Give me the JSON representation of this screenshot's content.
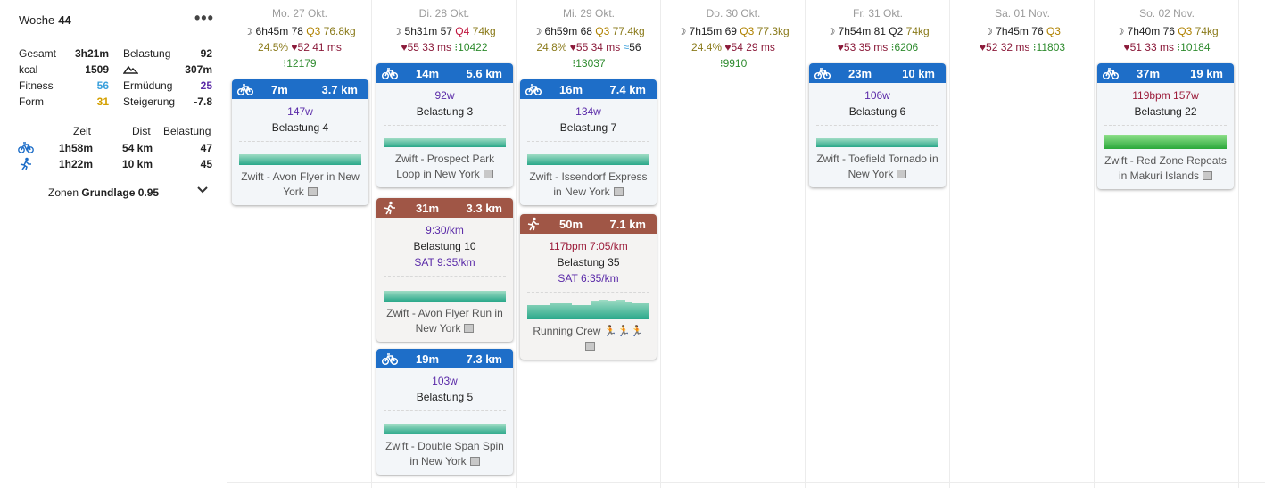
{
  "summary": {
    "woche_label": "Woche",
    "woche_num": "44",
    "gesamt_l": "Gesamt",
    "gesamt_v": "3h21m",
    "kcal_l": "kcal",
    "kcal_v": "1509",
    "fitness_l": "Fitness",
    "fitness_v": "56",
    "form_l": "Form",
    "form_v": "31",
    "belastung_l": "Belastung",
    "belastung_v": "92",
    "elev_v": "307m",
    "ermudung_l": "Ermüdung",
    "ermudung_v": "25",
    "steigerung_l": "Steigerung",
    "steigerung_v": "-7.8",
    "col_zeit": "Zeit",
    "col_dist": "Dist",
    "col_bel": "Belastung",
    "bike_zeit": "1h58m",
    "bike_dist": "54 km",
    "bike_bel": "47",
    "run_zeit": "1h22m",
    "run_dist": "10 km",
    "run_bel": "45",
    "zonen_l": "Zonen",
    "zonen_v": "Grundlage 0.95"
  },
  "days": [
    {
      "date": "Mo. 27 Okt.",
      "sleep": "6h45m",
      "sleep_score": "78",
      "q": "Q3",
      "weight": "76.8kg",
      "pct": "24.5%",
      "hr": "52",
      "hrv": "41 ms",
      "steps": "12179"
    },
    {
      "date": "Di. 28 Okt.",
      "sleep": "5h31m",
      "sleep_score": "57",
      "q": "Q4",
      "weight": "74kg",
      "hr": "55",
      "hrv": "33 ms",
      "steps": "10422"
    },
    {
      "date": "Mi. 29 Okt.",
      "sleep": "6h59m",
      "sleep_score": "68",
      "q": "Q3",
      "weight": "77.4kg",
      "pct": "24.8%",
      "hr": "55",
      "hrv": "34 ms",
      "resp": "56",
      "steps": "13037"
    },
    {
      "date": "Do. 30 Okt.",
      "sleep": "7h15m",
      "sleep_score": "69",
      "q": "Q3",
      "weight": "77.3kg",
      "pct": "24.4%",
      "hr": "54",
      "hrv": "29 ms",
      "steps": "9910"
    },
    {
      "date": "Fr. 31 Okt.",
      "sleep": "7h54m",
      "sleep_score": "81",
      "q": "Q2",
      "weight": "74kg",
      "hr": "53",
      "hrv": "35 ms",
      "steps": "6206"
    },
    {
      "date": "Sa. 01 Nov.",
      "sleep": "7h45m",
      "sleep_score": "76",
      "q": "Q3",
      "hr": "52",
      "hrv": "32 ms",
      "steps": "11803"
    },
    {
      "date": "So. 02 Nov.",
      "sleep": "7h40m",
      "sleep_score": "76",
      "q": "Q3",
      "weight": "74kg",
      "hr": "51",
      "hrv": "33 ms",
      "steps": "10184"
    }
  ],
  "activities": {
    "mo1": {
      "time": "7m",
      "dist": "3.7 km",
      "power": "147w",
      "load": "Belastung 4",
      "title": "Zwift - Avon Flyer in New York"
    },
    "di1": {
      "time": "14m",
      "dist": "5.6 km",
      "power": "92w",
      "load": "Belastung 3",
      "title": "Zwift - Prospect Park Loop in New York"
    },
    "di2": {
      "time": "31m",
      "dist": "3.3 km",
      "pace": "9:30/km",
      "load": "Belastung 10",
      "sat": "SAT 9:35/km",
      "title": "Zwift - Avon Flyer Run in New York"
    },
    "di3": {
      "time": "19m",
      "dist": "7.3 km",
      "power": "103w",
      "load": "Belastung 5",
      "title": "Zwift - Double Span Spin in New York"
    },
    "mi1": {
      "time": "16m",
      "dist": "7.4 km",
      "power": "134w",
      "load": "Belastung 7",
      "title": "Zwift - Issendorf Express in New York"
    },
    "mi2": {
      "time": "50m",
      "dist": "7.1 km",
      "hr": "117bpm 7:05/km",
      "load": "Belastung 35",
      "sat": "SAT 6:35/km",
      "title": "Running Crew 🏃🏃🏃"
    },
    "fr1": {
      "time": "23m",
      "dist": "10 km",
      "power": "106w",
      "load": "Belastung 6",
      "title": "Zwift - Toefield Tornado in New York"
    },
    "so1": {
      "time": "37m",
      "dist": "19 km",
      "hr": "119bpm 157w",
      "load": "Belastung 22",
      "title": "Zwift - Red Zone Repeats in Makuri Islands"
    }
  }
}
